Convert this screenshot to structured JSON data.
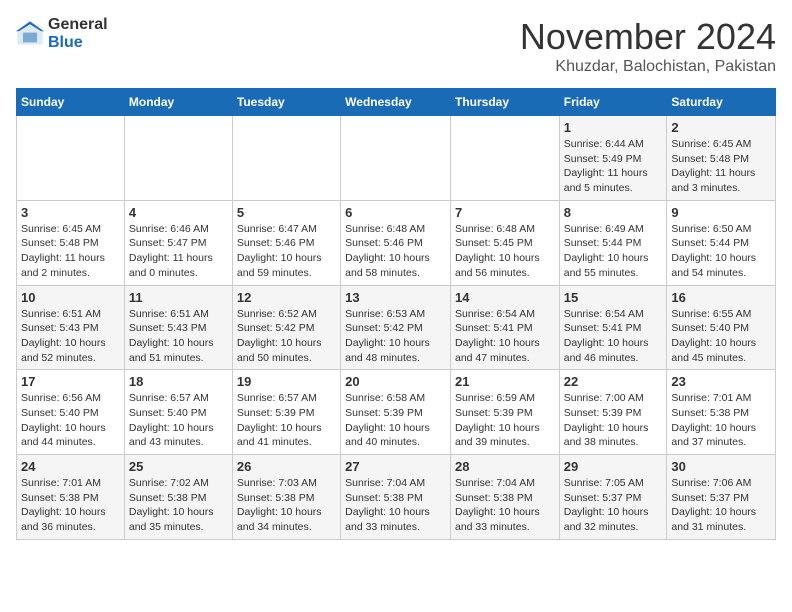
{
  "logo": {
    "general": "General",
    "blue": "Blue"
  },
  "title": "November 2024",
  "location": "Khuzdar, Balochistan, Pakistan",
  "headers": [
    "Sunday",
    "Monday",
    "Tuesday",
    "Wednesday",
    "Thursday",
    "Friday",
    "Saturday"
  ],
  "rows": [
    [
      {
        "day": "",
        "info": ""
      },
      {
        "day": "",
        "info": ""
      },
      {
        "day": "",
        "info": ""
      },
      {
        "day": "",
        "info": ""
      },
      {
        "day": "",
        "info": ""
      },
      {
        "day": "1",
        "info": "Sunrise: 6:44 AM\nSunset: 5:49 PM\nDaylight: 11 hours and 5 minutes."
      },
      {
        "day": "2",
        "info": "Sunrise: 6:45 AM\nSunset: 5:48 PM\nDaylight: 11 hours and 3 minutes."
      }
    ],
    [
      {
        "day": "3",
        "info": "Sunrise: 6:45 AM\nSunset: 5:48 PM\nDaylight: 11 hours and 2 minutes."
      },
      {
        "day": "4",
        "info": "Sunrise: 6:46 AM\nSunset: 5:47 PM\nDaylight: 11 hours and 0 minutes."
      },
      {
        "day": "5",
        "info": "Sunrise: 6:47 AM\nSunset: 5:46 PM\nDaylight: 10 hours and 59 minutes."
      },
      {
        "day": "6",
        "info": "Sunrise: 6:48 AM\nSunset: 5:46 PM\nDaylight: 10 hours and 58 minutes."
      },
      {
        "day": "7",
        "info": "Sunrise: 6:48 AM\nSunset: 5:45 PM\nDaylight: 10 hours and 56 minutes."
      },
      {
        "day": "8",
        "info": "Sunrise: 6:49 AM\nSunset: 5:44 PM\nDaylight: 10 hours and 55 minutes."
      },
      {
        "day": "9",
        "info": "Sunrise: 6:50 AM\nSunset: 5:44 PM\nDaylight: 10 hours and 54 minutes."
      }
    ],
    [
      {
        "day": "10",
        "info": "Sunrise: 6:51 AM\nSunset: 5:43 PM\nDaylight: 10 hours and 52 minutes."
      },
      {
        "day": "11",
        "info": "Sunrise: 6:51 AM\nSunset: 5:43 PM\nDaylight: 10 hours and 51 minutes."
      },
      {
        "day": "12",
        "info": "Sunrise: 6:52 AM\nSunset: 5:42 PM\nDaylight: 10 hours and 50 minutes."
      },
      {
        "day": "13",
        "info": "Sunrise: 6:53 AM\nSunset: 5:42 PM\nDaylight: 10 hours and 48 minutes."
      },
      {
        "day": "14",
        "info": "Sunrise: 6:54 AM\nSunset: 5:41 PM\nDaylight: 10 hours and 47 minutes."
      },
      {
        "day": "15",
        "info": "Sunrise: 6:54 AM\nSunset: 5:41 PM\nDaylight: 10 hours and 46 minutes."
      },
      {
        "day": "16",
        "info": "Sunrise: 6:55 AM\nSunset: 5:40 PM\nDaylight: 10 hours and 45 minutes."
      }
    ],
    [
      {
        "day": "17",
        "info": "Sunrise: 6:56 AM\nSunset: 5:40 PM\nDaylight: 10 hours and 44 minutes."
      },
      {
        "day": "18",
        "info": "Sunrise: 6:57 AM\nSunset: 5:40 PM\nDaylight: 10 hours and 43 minutes."
      },
      {
        "day": "19",
        "info": "Sunrise: 6:57 AM\nSunset: 5:39 PM\nDaylight: 10 hours and 41 minutes."
      },
      {
        "day": "20",
        "info": "Sunrise: 6:58 AM\nSunset: 5:39 PM\nDaylight: 10 hours and 40 minutes."
      },
      {
        "day": "21",
        "info": "Sunrise: 6:59 AM\nSunset: 5:39 PM\nDaylight: 10 hours and 39 minutes."
      },
      {
        "day": "22",
        "info": "Sunrise: 7:00 AM\nSunset: 5:39 PM\nDaylight: 10 hours and 38 minutes."
      },
      {
        "day": "23",
        "info": "Sunrise: 7:01 AM\nSunset: 5:38 PM\nDaylight: 10 hours and 37 minutes."
      }
    ],
    [
      {
        "day": "24",
        "info": "Sunrise: 7:01 AM\nSunset: 5:38 PM\nDaylight: 10 hours and 36 minutes."
      },
      {
        "day": "25",
        "info": "Sunrise: 7:02 AM\nSunset: 5:38 PM\nDaylight: 10 hours and 35 minutes."
      },
      {
        "day": "26",
        "info": "Sunrise: 7:03 AM\nSunset: 5:38 PM\nDaylight: 10 hours and 34 minutes."
      },
      {
        "day": "27",
        "info": "Sunrise: 7:04 AM\nSunset: 5:38 PM\nDaylight: 10 hours and 33 minutes."
      },
      {
        "day": "28",
        "info": "Sunrise: 7:04 AM\nSunset: 5:38 PM\nDaylight: 10 hours and 33 minutes."
      },
      {
        "day": "29",
        "info": "Sunrise: 7:05 AM\nSunset: 5:37 PM\nDaylight: 10 hours and 32 minutes."
      },
      {
        "day": "30",
        "info": "Sunrise: 7:06 AM\nSunset: 5:37 PM\nDaylight: 10 hours and 31 minutes."
      }
    ]
  ]
}
